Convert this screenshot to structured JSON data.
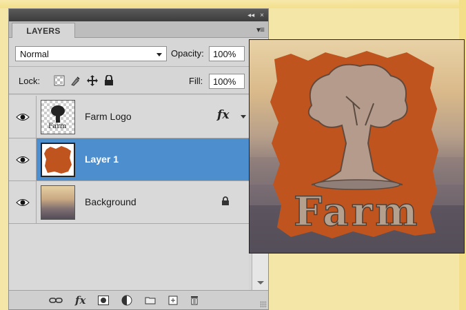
{
  "panel": {
    "collapse_glyph": "◂◂",
    "close_glyph": "×",
    "tab_label": "LAYERS",
    "menu_glyph": "▾≡"
  },
  "options": {
    "blend_mode": "Normal",
    "opacity_label": "Opacity:",
    "opacity_value": "100%",
    "lock_label": "Lock:",
    "fill_label": "Fill:",
    "fill_value": "100%"
  },
  "layers": [
    {
      "name": "Farm Logo",
      "visible": true,
      "has_fx": true,
      "fx_label": "fx",
      "selected": false,
      "thumb": "farm-logo-thumbnail"
    },
    {
      "name": "Layer 1",
      "visible": true,
      "has_fx": false,
      "selected": true,
      "thumb": "orange-patch-thumbnail"
    },
    {
      "name": "Background",
      "visible": true,
      "locked": true,
      "selected": false,
      "thumb": "landscape-thumbnail"
    }
  ],
  "thumb_labels": {
    "farm_logo": "Farm"
  },
  "toolbar": {
    "fx_label": "fx",
    "icons": [
      "link-layers-icon",
      "layer-style-icon",
      "add-mask-icon",
      "adjustment-layer-icon",
      "new-group-icon",
      "new-layer-icon",
      "delete-layer-icon"
    ]
  },
  "canvas": {
    "logo_text": "Farm",
    "colors": {
      "orange": "#c0541e",
      "selection_blue": "#4d8fce"
    }
  }
}
